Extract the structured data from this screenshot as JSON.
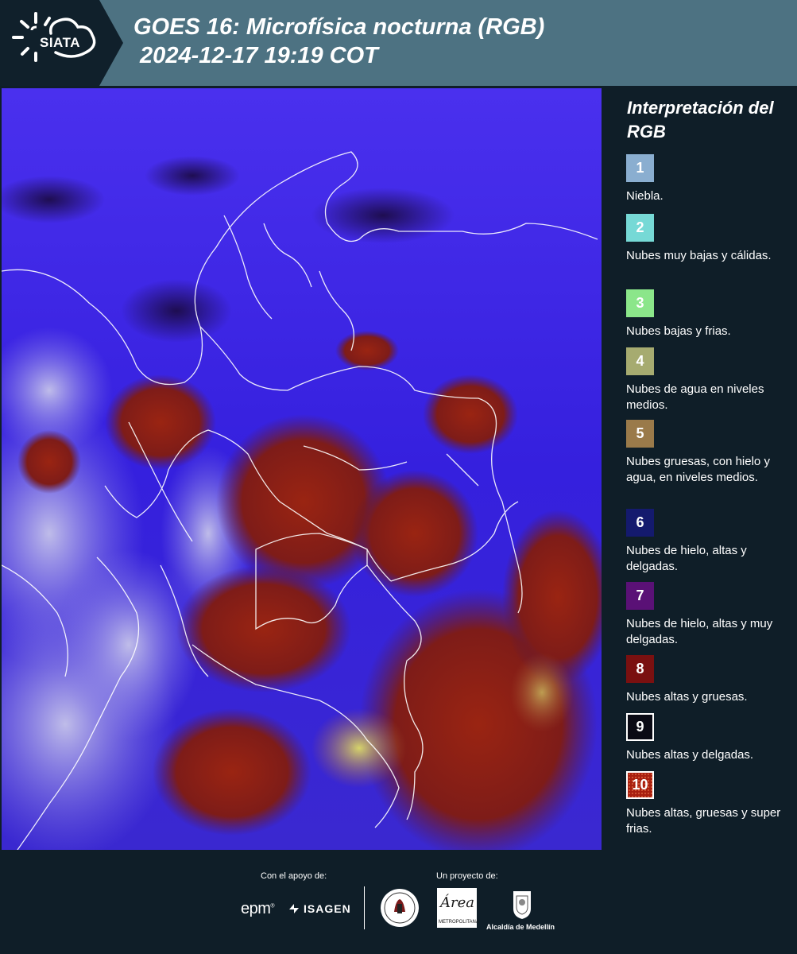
{
  "header": {
    "logo_text": "SIATA",
    "title": "GOES 16: Microfísica nocturna (RGB)\n 2024-12-17 19:19 COT"
  },
  "map": {
    "description_colors": {
      "background": "#3a24e0",
      "deep_convection": "#8a1f12",
      "low_clouds": "#b8c0e0",
      "boundaries": "#ffffff"
    }
  },
  "legend": {
    "title": "Interpretación del RGB",
    "items": [
      {
        "number": "1",
        "color": "#8aaed0",
        "label": "Niebla."
      },
      {
        "number": "2",
        "color": "#76d9d6",
        "label": "Nubes muy bajas y cálidas."
      },
      {
        "number": "3",
        "color": "#8be68a",
        "label": "Nubes bajas y frias."
      },
      {
        "number": "4",
        "color": "#a6ab70",
        "label": "Nubes de agua en niveles medios."
      },
      {
        "number": "5",
        "color": "#9a7a4a",
        "label": "Nubes gruesas, con hielo y agua, en niveles medios."
      },
      {
        "number": "6",
        "color": "#141a6e",
        "label": "Nubes de hielo, altas y delgadas."
      },
      {
        "number": "7",
        "color": "#5a1176",
        "label": "Nubes de hielo, altas y muy delgadas."
      },
      {
        "number": "8",
        "color": "#7a1010",
        "label": "Nubes altas y gruesas."
      },
      {
        "number": "9",
        "color": "#0a0a14",
        "label": "Nubes altas y delgadas."
      },
      {
        "number": "10",
        "color": "#a81f10",
        "label": "Nubes altas, gruesas y super frias."
      }
    ]
  },
  "footer": {
    "support_label": "Con el apoyo de:",
    "project_label": "Un proyecto de:",
    "epm": "epm",
    "isagen": "ISAGEN",
    "area_logo": "Área",
    "area_sub": "METROPOLITANA",
    "alcaldia": "Alcaldía de Medellín"
  }
}
